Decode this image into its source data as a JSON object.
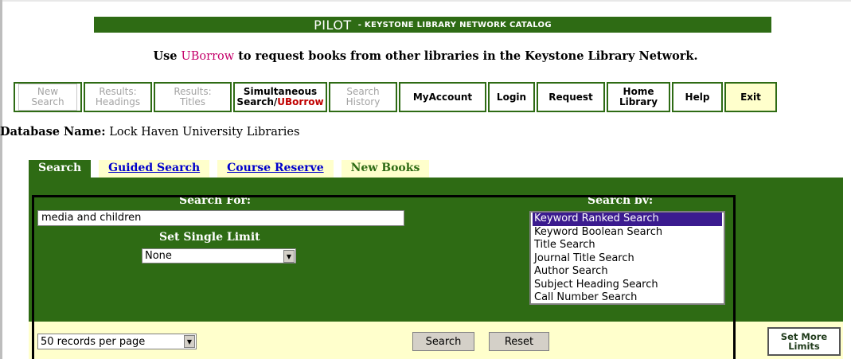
{
  "banner": {
    "title": "PILOT",
    "subtitle": "- KEYSTONE LIBRARY NETWORK CATALOG"
  },
  "notice": {
    "prefix": "Use ",
    "link": "UBorrow",
    "suffix": " to request books from other libraries in the Keystone Library Network."
  },
  "nav": {
    "new_search": [
      "New",
      "Search"
    ],
    "results_headings": [
      "Results:",
      "Headings"
    ],
    "results_titles": [
      "Results:",
      "Titles"
    ],
    "simultaneous": [
      "Simultaneous",
      "Search/",
      "UBorrow"
    ],
    "search_history": [
      "Search",
      "History"
    ],
    "myaccount": "MyAccount",
    "login": "Login",
    "request": "Request",
    "home_library": [
      "Home",
      "Library"
    ],
    "help": "Help",
    "exit": "Exit"
  },
  "database": {
    "label": "Database Name:",
    "value": " Lock Haven University Libraries"
  },
  "tabs": {
    "search": "Search",
    "guided": "Guided Search",
    "course": "Course Reserve",
    "newbooks": "New Books"
  },
  "form": {
    "search_for_label": "Search For:",
    "search_by_label": "Search by:",
    "search_value": "media and children",
    "limit_label": "Set Single Limit",
    "limit_value": "None",
    "search_by_options": [
      "Keyword Ranked Search",
      "Keyword Boolean Search",
      "Title Search",
      "Journal Title Search",
      "Author Search",
      "Subject Heading Search",
      "Call Number Search"
    ],
    "selected_option": "Keyword Ranked Search",
    "per_page_value": "50 records per page",
    "search_button": "Search",
    "reset_button": "Reset",
    "more_limits": [
      "Set More",
      "Limits"
    ]
  },
  "colors": {
    "green": "#2e6b14",
    "cream": "#ffffcc",
    "link": "#0000cc",
    "uborrow": "#c4006a",
    "selection": "#3b1b8f"
  }
}
